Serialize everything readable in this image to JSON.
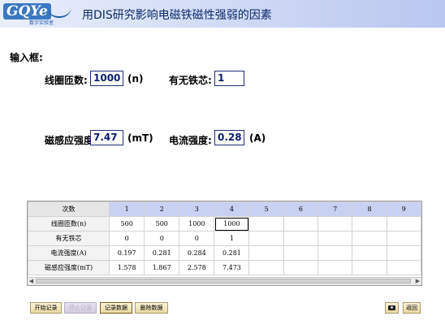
{
  "header": {
    "logo_text": "GQYe",
    "logo_sub": "数字实验室",
    "title": "用DIS研究影响电磁铁磁性强弱的因素"
  },
  "input": {
    "section_label": "输入框:",
    "coil_turns": {
      "label": "线圈匝数:",
      "value": "1000",
      "unit": "(n)"
    },
    "iron_core": {
      "label": "有无铁芯:",
      "value": "1"
    },
    "magnetic_field": {
      "label": "磁感应强度:",
      "value": "7.47",
      "unit": "(mT)"
    },
    "current": {
      "label": "电流强度:",
      "value": "0.28",
      "unit": "(A)"
    }
  },
  "table": {
    "header_label": "次数",
    "columns": [
      "1",
      "2",
      "3",
      "4",
      "5",
      "6",
      "7",
      "8",
      "9"
    ],
    "rows": [
      {
        "label": "线圈匝数(n)",
        "cells": [
          "500",
          "500",
          "1000",
          "1000",
          "",
          "",
          "",
          "",
          ""
        ]
      },
      {
        "label": "有无铁芯",
        "cells": [
          "0",
          "0",
          "0",
          "1",
          "",
          "",
          "",
          "",
          ""
        ]
      },
      {
        "label": "电流强度(A)",
        "cells": [
          "0.197",
          "0.281",
          "0.284",
          "0.281",
          "",
          "",
          "",
          "",
          ""
        ]
      },
      {
        "label": "磁感应强度(mT)",
        "cells": [
          "1.578",
          "1.867",
          "2.578",
          "7.473",
          "",
          "",
          "",
          "",
          ""
        ]
      }
    ]
  },
  "buttons": {
    "start": "开始记录",
    "stop": "停止记录",
    "record": "记录数据",
    "delete": "删除数据",
    "camera": "camera-icon",
    "back": "返回"
  },
  "colors": {
    "header_gradient_end": "#b9c6ef",
    "input_border": "#1f2f7a",
    "input_text": "#0a1d6a",
    "table_header": "#c9d1f3"
  }
}
